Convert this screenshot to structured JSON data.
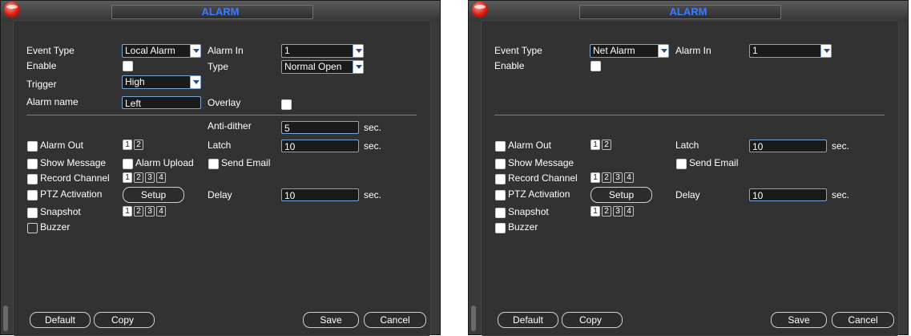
{
  "left": {
    "title": "ALARM",
    "event_type_label": "Event Type",
    "event_type_value": "Local Alarm",
    "alarm_in_label": "Alarm In",
    "alarm_in_value": "1",
    "enable_label": "Enable",
    "type_label": "Type",
    "type_value": "Normal Open",
    "trigger_label": "Trigger",
    "trigger_value": "High",
    "alarm_name_label": "Alarm name",
    "alarm_name_value": "Left",
    "overlay_label": "Overlay",
    "anti_dither_label": "Anti-dither",
    "anti_dither_value": "5",
    "anti_dither_unit": "sec.",
    "alarm_out_label": "Alarm Out",
    "alarm_out_channels": [
      "1",
      "2"
    ],
    "latch_label": "Latch",
    "latch_value": "10",
    "latch_unit": "sec.",
    "show_message_label": "Show Message",
    "alarm_upload_label": "Alarm Upload",
    "send_email_label": "Send Email",
    "record_channel_label": "Record Channel",
    "record_channels": [
      "1",
      "2",
      "3",
      "4"
    ],
    "ptz_label": "PTZ Activation",
    "setup_label": "Setup",
    "delay_label": "Delay",
    "delay_value": "10",
    "delay_unit": "sec.",
    "snapshot_label": "Snapshot",
    "snapshot_channels": [
      "1",
      "2",
      "3",
      "4"
    ],
    "buzzer_label": "Buzzer",
    "default_label": "Default",
    "copy_label": "Copy",
    "save_label": "Save",
    "cancel_label": "Cancel"
  },
  "right": {
    "title": "ALARM",
    "event_type_label": "Event Type",
    "event_type_value": "Net Alarm",
    "alarm_in_label": "Alarm In",
    "alarm_in_value": "1",
    "enable_label": "Enable",
    "alarm_out_label": "Alarm Out",
    "alarm_out_channels": [
      "1",
      "2"
    ],
    "latch_label": "Latch",
    "latch_value": "10",
    "latch_unit": "sec.",
    "show_message_label": "Show Message",
    "send_email_label": "Send Email",
    "record_channel_label": "Record Channel",
    "record_channels": [
      "1",
      "2",
      "3",
      "4"
    ],
    "ptz_label": "PTZ Activation",
    "setup_label": "Setup",
    "delay_label": "Delay",
    "delay_value": "10",
    "delay_unit": "sec.",
    "snapshot_label": "Snapshot",
    "snapshot_channels": [
      "1",
      "2",
      "3",
      "4"
    ],
    "buzzer_label": "Buzzer",
    "default_label": "Default",
    "copy_label": "Copy",
    "save_label": "Save",
    "cancel_label": "Cancel"
  },
  "colors": {
    "title": "#3b7bff",
    "panel_bg": "#323232",
    "input_border": "#7aa4d8"
  }
}
